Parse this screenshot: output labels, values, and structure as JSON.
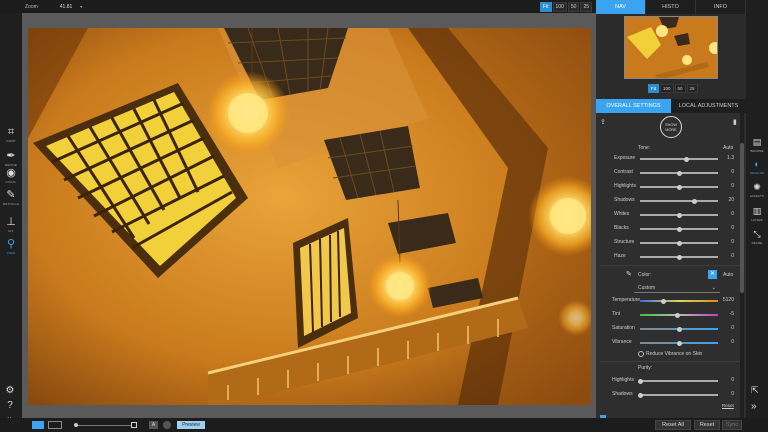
{
  "topbar": {
    "zoom_label": "Zoom",
    "zoom_value": "41.81",
    "zoom_chevron": "▾"
  },
  "zoom_buttons": [
    "Fit",
    "100",
    "50",
    "25"
  ],
  "left_tools": [
    {
      "name": "crop",
      "label": "CROP",
      "icon": "⌗"
    },
    {
      "name": "refine",
      "label": "REFINE",
      "icon": "✒"
    },
    {
      "name": "local",
      "label": "LOCAL",
      "icon": "◉"
    },
    {
      "name": "retouch",
      "label": "RETOUCH",
      "icon": "✎"
    },
    {
      "name": "fix",
      "label": "FIX",
      "icon": "⊥"
    },
    {
      "name": "view",
      "label": "VIEW",
      "icon": "⚲"
    }
  ],
  "right_tabs": [
    "NAV",
    "HISTO",
    "INFO"
  ],
  "nav_zooms": [
    "Fit",
    "100",
    "50",
    "25"
  ],
  "settings_tabs": [
    "OVERALL SETTINGS",
    "LOCAL ADJUSTMENTS"
  ],
  "show_more": "SHOW MORE",
  "tone": {
    "label": "Tone:",
    "auto": "Auto"
  },
  "tone_sliders": [
    {
      "label": "Exposure",
      "value": "1.3",
      "pos": 0.6
    },
    {
      "label": "Contrast",
      "value": "0",
      "pos": 0.5
    },
    {
      "label": "Highlights",
      "value": "0",
      "pos": 0.5
    },
    {
      "label": "Shadows",
      "value": "20",
      "pos": 0.7
    },
    {
      "label": "Whites",
      "value": "0",
      "pos": 0.5
    },
    {
      "label": "Blacks",
      "value": "0",
      "pos": 0.5
    },
    {
      "label": "Structure",
      "value": "0",
      "pos": 0.5
    },
    {
      "label": "Haze",
      "value": "0",
      "pos": 0.5
    }
  ],
  "color": {
    "label": "Color:",
    "auto": "Auto",
    "dropdown": "Custom"
  },
  "color_sliders": [
    {
      "label": "Temperature",
      "value": "5120",
      "pos": 0.3
    },
    {
      "label": "Tint",
      "value": "-5",
      "pos": 0.48
    },
    {
      "label": "Saturation",
      "value": "0",
      "pos": 0.5
    },
    {
      "label": "Vibrance",
      "value": "0",
      "pos": 0.5
    }
  ],
  "reduce_vibrance": "Reduce Vibrance on Skin",
  "purity": {
    "label": "Purity:",
    "reset": "Reset"
  },
  "purity_sliders": [
    {
      "label": "Highlights",
      "value": "0",
      "pos": 0.0
    },
    {
      "label": "Shadows",
      "value": "0",
      "pos": 0.0
    }
  ],
  "far_right": [
    {
      "name": "browse",
      "label": "BROWSE",
      "icon": "▤"
    },
    {
      "name": "develop",
      "label": "DEVELOP",
      "icon": "◐"
    },
    {
      "name": "effects",
      "label": "EFFECTS",
      "icon": "✺"
    },
    {
      "name": "layers",
      "label": "LAYERS",
      "icon": "▥"
    },
    {
      "name": "resize",
      "label": "RESIZE",
      "icon": "⤡"
    }
  ],
  "bottom": {
    "preview": "Preview",
    "reset_all": "Reset All",
    "reset": "Reset",
    "sync": "Sync"
  },
  "colors": {
    "accent": "#3aa4f0",
    "photo_main": "#d98a1f"
  }
}
